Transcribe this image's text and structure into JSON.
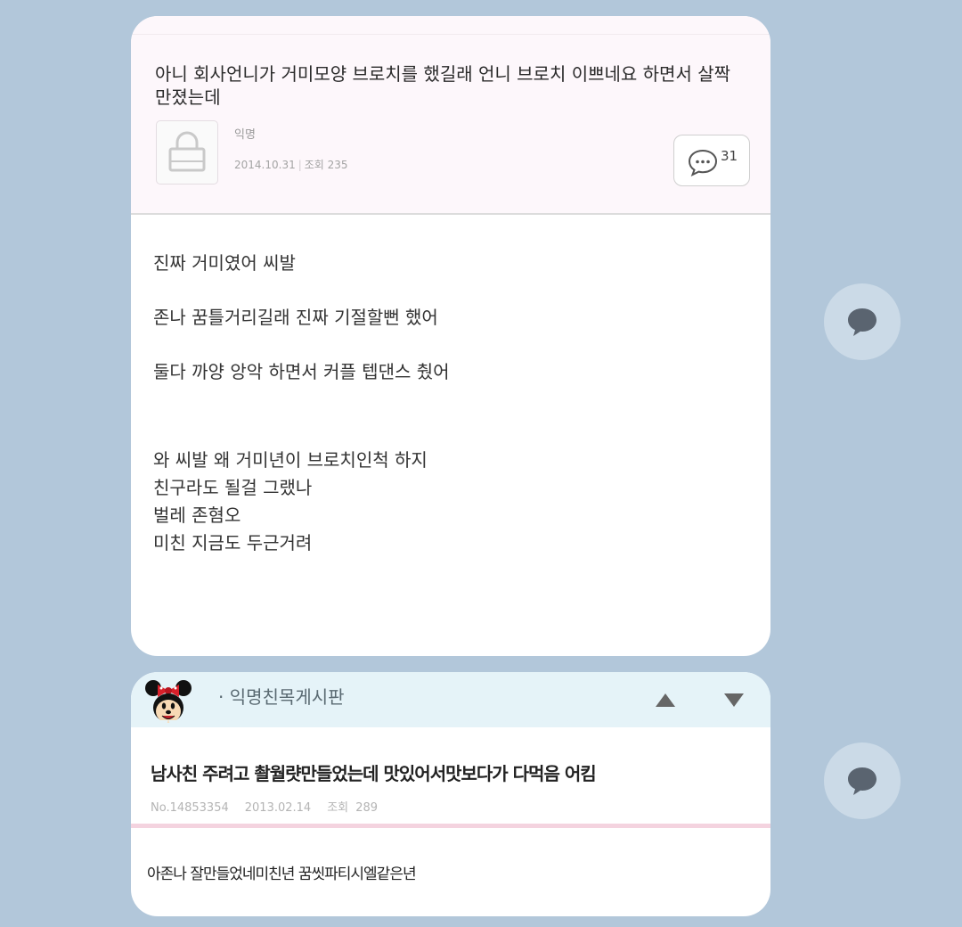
{
  "post1": {
    "title": "아니 회사언니가 거미모양 브로치를 했길래 언니 브로치 이쁘네요 하면서 살짝 만졌는데",
    "author": "익명",
    "date": "2014.10.31",
    "views": "조회 235",
    "comment_count": "31",
    "body_lines": [
      "진짜 거미였어 씨발",
      "존나 꿈틀거리길래 진짜 기절할뻔 했어",
      "둘다 까양 앙악 하면서 커플 텝댄스 췄어",
      "와 씨발 왜 거미년이 브로치인척 하지",
      "친구라도 될걸 그랬나",
      "벌레 존혐오",
      "미친 지금도 두근거려"
    ]
  },
  "post2": {
    "board_title": "· 익명친목게시판",
    "title": "남사친 주려고 촬월럇만들었는데 맛있어서맛보다가 다먹음 어킴",
    "post_no": "No.14853354",
    "date": "2013.02.14",
    "views": "조회 289",
    "body": "아존나 잘만들었네미친년 꿈씻파티시엘같은년"
  },
  "icons": {
    "lock": "lock-icon",
    "comment": "comment-bubble-icon",
    "share": "speech-bubble-icon",
    "mascot": "minnie-mouse-icon",
    "up": "arrow-up-icon",
    "down": "arrow-down-icon"
  },
  "colors": {
    "background": "#b2c7da",
    "card": "#ffffff",
    "post1_header": "#fdf7fb",
    "post2_header": "#e5f3f8",
    "pink_divider": "#f4d3df",
    "share_button": "#cbdae7"
  }
}
